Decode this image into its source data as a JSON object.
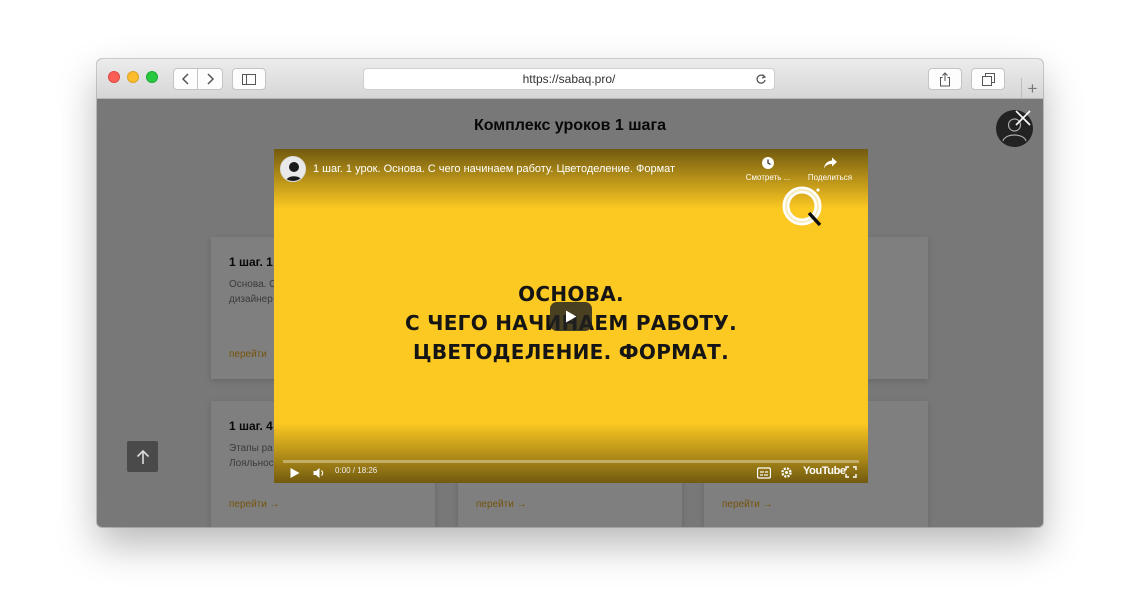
{
  "browser": {
    "url": "https://sabaq.pro/",
    "new_tab_symbol": "+"
  },
  "page": {
    "title": "Комплекс уроков 1 шага",
    "cards": [
      {
        "title": "1 шаг. 1 у",
        "text_lines": [
          "Основа. С",
          "дизайнер"
        ],
        "link": "перейти"
      },
      {
        "title": "1 шаг. 4 у",
        "text_lines": [
          "Этапы ра",
          "Лояльнос"
        ],
        "link": "перейти →"
      },
      {
        "title": "",
        "text_lines": [],
        "link": "перейти →"
      },
      {
        "title": "",
        "text_lines": [],
        "link": "перейти →"
      }
    ]
  },
  "video": {
    "title": "1 шаг. 1 урок. Основа. С чего начинаем работу. Цветоделение. Формат",
    "watch_later_label": "Смотреть ...",
    "share_label": "Поделиться",
    "slide_lines": [
      "ОСНОВА.",
      "С ЧЕГО НАЧИНАЕМ РАБОТУ.",
      "ЦВЕТОДЕЛЕНИЕ. ФОРМАТ."
    ],
    "time_display": "0:00 / 18:26",
    "brand": "YouTube",
    "progress_fraction": 0.0,
    "accent_color": "#fcc822"
  },
  "icons": {
    "back": "chevron-left-icon",
    "forward": "chevron-right-icon",
    "sidebar": "sidebar-icon",
    "reload": "reload-icon",
    "share": "share-icon",
    "tabs": "tabs-icon",
    "close": "close-icon",
    "scroll_top": "arrow-up-icon"
  }
}
